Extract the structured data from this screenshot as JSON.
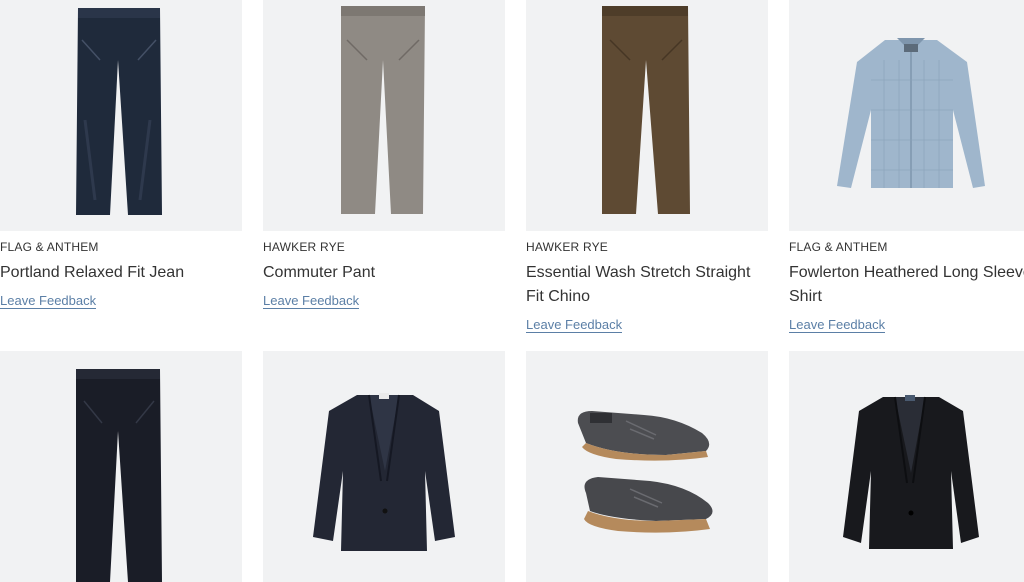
{
  "products": [
    {
      "brand": "FLAG & ANTHEM",
      "title": "Portland Relaxed Fit Jean",
      "feedback": "Leave Feedback",
      "icon": "dark-jeans-image"
    },
    {
      "brand": "HAWKER RYE",
      "title": "Commuter Pant",
      "feedback": "Leave Feedback",
      "icon": "gray-pant-image"
    },
    {
      "brand": "HAWKER RYE",
      "title": "Essential Wash Stretch Straight Fit Chino",
      "feedback": "Leave Feedback",
      "icon": "brown-chino-image"
    },
    {
      "brand": "FLAG & ANTHEM",
      "title": "Fowlerton Heathered Long Sleeve Shirt",
      "feedback": "Leave Feedback",
      "icon": "plaid-shirt-image"
    },
    {
      "icon": "navy-trouser-image"
    },
    {
      "icon": "navy-blazer-image"
    },
    {
      "icon": "gray-oxford-shoes-image"
    },
    {
      "icon": "black-blazer-image"
    }
  ],
  "colors": {
    "tile_bg": "#f1f2f3",
    "link": "#5b7fa6",
    "text": "#333333"
  }
}
